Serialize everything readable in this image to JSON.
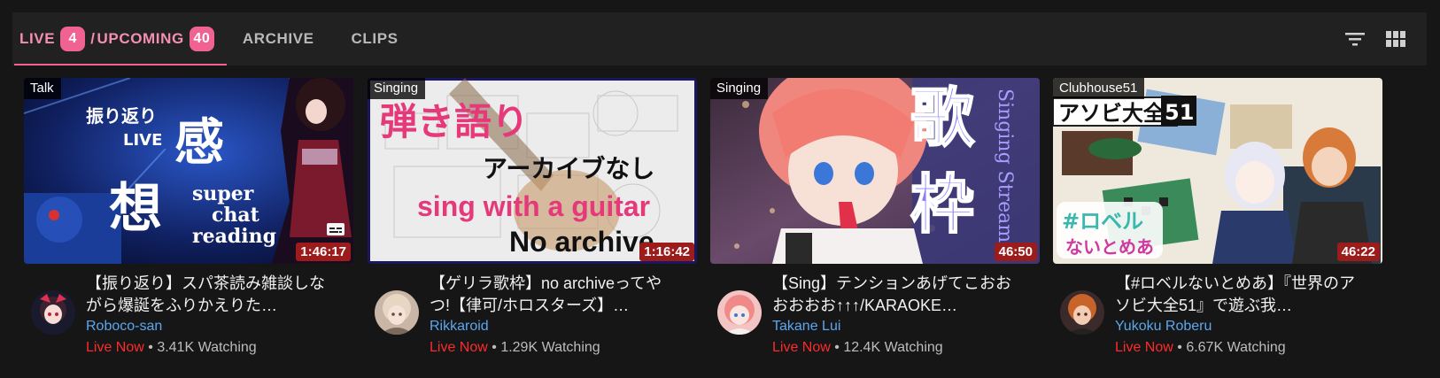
{
  "tabs": {
    "live_label": "LIVE",
    "live_count": "4",
    "separator": "/",
    "upcoming_label": "UPCOMING",
    "upcoming_count": "40",
    "archive_label": "ARCHIVE",
    "clips_label": "CLIPS"
  },
  "toolbar_icons": [
    "filter-icon",
    "grid-view-icon"
  ],
  "colors": {
    "accent": "#f06292",
    "live_red": "#ff2a2a",
    "channel_blue": "#5ba7f0",
    "background": "#161616",
    "toolbar": "#212121"
  },
  "cards": [
    {
      "topic": "Talk",
      "duration": "1:46:17",
      "title": "【振り返り】スパ茶読み雑談しながら爆誕をふりかえりた…",
      "channel": "Roboco-san",
      "status_live": "Live Now",
      "status_sep": " • ",
      "watching": "3.41K Watching",
      "thumb_text": [
        "振り返り",
        "LIVE",
        "感",
        "想",
        "super",
        "chat",
        "reading"
      ],
      "has_captions_icon": true
    },
    {
      "topic": "Singing",
      "duration": "1:16:42",
      "title": "【ゲリラ歌枠】no archiveってやつ!【律可/ホロスターズ】…",
      "channel": "Rikkaroid",
      "status_live": "Live Now",
      "status_sep": " • ",
      "watching": "1.29K Watching",
      "thumb_text": [
        "弾き語り",
        "アーカイブなし",
        "sing with a guitar",
        "No archive"
      ]
    },
    {
      "topic": "Singing",
      "duration": "46:50",
      "title": "【Sing】テンションあげてこおおおおおお↑↑↑/KARAOKE…",
      "channel": "Takane Lui",
      "status_live": "Live Now",
      "status_sep": " • ",
      "watching": "12.4K Watching",
      "thumb_text": [
        "歌",
        "枠",
        "Singing Stream"
      ]
    },
    {
      "topic": "Clubhouse51",
      "duration": "46:22",
      "title": "【#ロベルないとめあ】『世界のアソビ大全51』で遊ぶ我…",
      "channel": "Yukoku Roberu",
      "status_live": "Live Now",
      "status_sep": " • ",
      "watching": "6.67K Watching",
      "thumb_text": [
        "アソビ大全",
        "51",
        "#ロベル",
        "ないとめあ"
      ]
    }
  ]
}
